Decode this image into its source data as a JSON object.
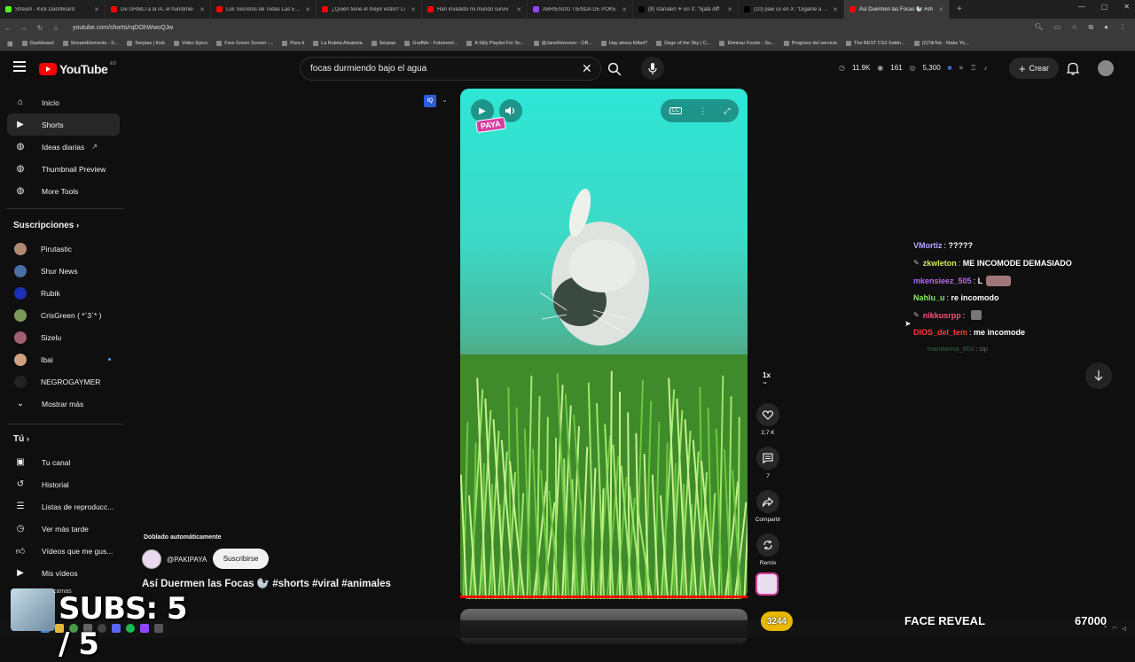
{
  "browser": {
    "tabs": [
      {
        "title": "Stream - Kick Dashboard",
        "color": "#53fc18"
      },
      {
        "title": "De GHIBLI a la IA, el hundimie",
        "color": "#ff0000"
      },
      {
        "title": "Los Secretos de Todas Las Estru",
        "color": "#ff0000"
      },
      {
        "title": "¿Quién tiene el mejor estilo? Li",
        "color": "#ff0000"
      },
      {
        "title": "Han invadido mi mundo surviv",
        "color": "#ff0000"
      },
      {
        "title": "ABRIENDO TIENDA DE POKE",
        "color": "#9146ff"
      },
      {
        "title": "(8) starialen ✳ en X: \"ojalá diff",
        "color": "#000000"
      },
      {
        "title": "(10) paw co en X: \"Diganle a Se",
        "color": "#000000"
      },
      {
        "title": "Así Duermen las Focas 🦭 #sh",
        "color": "#ff0000"
      }
    ],
    "active_tab": 8,
    "new_tab": "+",
    "window_controls": [
      "—",
      "▢",
      "✕"
    ],
    "url": "youtube.com/shorts/rqDOhWwoQJw",
    "bookmarks": [
      "Dashboard",
      "StreamElements - S...",
      "Serpias | Kick",
      "Video Epico",
      "Free Green Screen -...",
      "Para ti",
      "La Ruleta Aleatoria",
      "Serpias",
      "GrafMe - Fotomont...",
      "A Silly Playlist For Sc...",
      "@JaneRemover - OB...",
      "Hay ahora fútbol?",
      "Dege of the Sky | C...",
      "Eliminar Fondo - Su...",
      "Progreso del servicio",
      "The BEST CS2 Settin...",
      "(2)TikTok - Make Yo..."
    ]
  },
  "header": {
    "logo_text": "YouTube",
    "logo_region": "ES",
    "search_value": "focas durmiendo bajo el agua",
    "stats": {
      "views": "11.9K",
      "viewers": "161",
      "followers": "5,300"
    },
    "create_label": "Crear"
  },
  "sidebar": {
    "main": [
      {
        "label": "Inicio",
        "icon": "home-icon"
      },
      {
        "label": "Shorts",
        "icon": "shorts-icon",
        "selected": true
      },
      {
        "label": "Ideas diarias",
        "icon": "ideas-icon",
        "external": true
      },
      {
        "label": "Thumbnail Preview",
        "icon": "thumbnail-icon"
      },
      {
        "label": "More Tools",
        "icon": "tools-icon"
      }
    ],
    "subs_heading": "Suscripciones",
    "subscriptions": [
      {
        "label": "Pirutastic",
        "color": "#b08a70"
      },
      {
        "label": "Shur News",
        "color": "#4a6fa5"
      },
      {
        "label": "Rubik",
        "color": "#1c2fb5"
      },
      {
        "label": "CrisGreen ( *´3`* )",
        "color": "#7c9a5c"
      },
      {
        "label": "Sizelu",
        "color": "#a06070"
      },
      {
        "label": "Ibai",
        "color": "#d0a080",
        "new": true
      },
      {
        "label": "NEGROGAYMER",
        "color": "#222222"
      }
    ],
    "show_more": "Mostrar más",
    "you_heading": "Tú",
    "you_items": [
      {
        "label": "Tu canal",
        "icon": "channel-icon"
      },
      {
        "label": "Historial",
        "icon": "history-icon"
      },
      {
        "label": "Listas de reproducc...",
        "icon": "playlists-icon"
      },
      {
        "label": "Ver más tarde",
        "icon": "watch-later-icon"
      },
      {
        "label": "Vídeos que me gus...",
        "icon": "liked-icon"
      },
      {
        "label": "Mis vídeos",
        "icon": "my-videos-icon"
      }
    ]
  },
  "short": {
    "dubbing_label": "Doblado automáticamente",
    "channel": "@PAKIPAYA",
    "subscribe_label": "Suscribirse",
    "title": "Así Duermen las Focas 🦭 #shorts #viral #animales",
    "watermark": "PAYA",
    "speed": "1x",
    "likes": "2,7 K",
    "comments": "7",
    "share_label": "Compartir",
    "remix_label": "Remix"
  },
  "chat": [
    {
      "user": "VMortiz",
      "color": "#b9a8ff",
      "text": "?????",
      "badge": false
    },
    {
      "user": "zkwleton",
      "color": "#d4e85a",
      "text": "ME INCOMODE DEMASIADO",
      "badge": true
    },
    {
      "user": "mkensieez_505",
      "color": "#b06cf0",
      "text": "L",
      "badge": false,
      "emote": true
    },
    {
      "user": "Nahlu_u",
      "color": "#8ee85a",
      "text": "re incomodo",
      "badge": false
    },
    {
      "user": "nikkusrpp",
      "color": "#ff4d7a",
      "text": "",
      "badge": true,
      "emote": true
    },
    {
      "user": "DIOS_del_tem",
      "color": "#ff3b3b",
      "text": "me incomode",
      "badge": false
    },
    {
      "user": "mandarina_003",
      "color": "#4a8a5a",
      "text": "sip",
      "badge": false,
      "faded": true
    }
  ],
  "overlay": {
    "subs_text": "SUBS: 5 / 5",
    "cam_label": "camas",
    "goal_badge": "3244",
    "goal_label": "FACE REVEAL",
    "goal_target": "67000"
  }
}
